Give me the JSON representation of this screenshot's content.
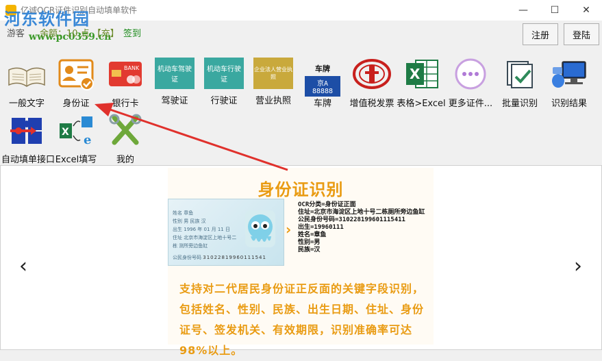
{
  "window": {
    "title": "亿诚OCR证件识别自动填单软件",
    "controls": {
      "minimize": "—",
      "maximize": "☐",
      "close": "✕"
    }
  },
  "watermark": {
    "name": "河东软件园",
    "url": "www.pc0359.cn"
  },
  "account": {
    "login_label": "游客",
    "balance": "余额：10 点 【充】",
    "signin": "签到"
  },
  "header_buttons": {
    "register": "注册",
    "login": "登陆"
  },
  "tools_row1": [
    {
      "label": "一般文字",
      "icon": "book-icon"
    },
    {
      "label": "身份证",
      "icon": "id-card-icon"
    },
    {
      "label": "银行卡",
      "icon": "bank-card-icon"
    },
    {
      "label": "驾驶证",
      "icon": "driver-license-icon",
      "card_text": "机动车驾驶证"
    },
    {
      "label": "行驶证",
      "icon": "vehicle-license-icon",
      "card_text": "机动车行驶证"
    },
    {
      "label": "营业执照",
      "icon": "business-license-icon",
      "card_text": "企业法人营业执照"
    },
    {
      "label": "车牌",
      "icon": "license-plate-icon",
      "plate_title": "车牌",
      "plate_text": "京A 88888"
    },
    {
      "label": "增值税发票",
      "icon": "vat-invoice-icon"
    },
    {
      "label": "表格>Excel",
      "icon": "excel-icon"
    },
    {
      "label": "更多证件...",
      "icon": "more-icon"
    },
    {
      "label": "批量识别",
      "icon": "batch-icon"
    },
    {
      "label": "识别结果",
      "icon": "result-icon"
    }
  ],
  "tools_row2": [
    {
      "label": "自动填单接口",
      "icon": "puzzle-icon"
    },
    {
      "label": "Excel填写",
      "icon": "excel-fill-icon"
    },
    {
      "label": "我的",
      "icon": "tools-icon"
    }
  ],
  "carousel": {
    "prev": "‹",
    "next": "›",
    "title": "身份证识别",
    "card_stamp": "公民身份号码",
    "card_number": "31022819960111541",
    "card_fields": [
      {
        "k": "姓名",
        "v": "章鱼"
      },
      {
        "k": "性别",
        "v": "男  民族 汉"
      },
      {
        "k": "出生",
        "v": "1996 年 01 月 11 日"
      },
      {
        "k": "住址",
        "v": "北京市海淀区上地十号二栋 测所旁边鱼缸"
      }
    ],
    "ocr_lines": [
      "OCR分类=身份证正面",
      "住址=北京市海淀区上地十号二栋厕所旁边鱼缸",
      "公民身份号码=310228199601115411",
      "出生=19960111",
      "姓名=章鱼",
      "性别=男",
      "民族=汉"
    ],
    "description": "支持对二代居民身份证正反面的关键字段识别，包括姓名、性别、民族、出生日期、住址、身份证号、签发机关、有效期限，识别准确率可达98%以上。"
  },
  "colors": {
    "accent_orange": "#e99b12",
    "watermark_blue": "#2a7fd4",
    "arrow_red": "#e0312c"
  }
}
